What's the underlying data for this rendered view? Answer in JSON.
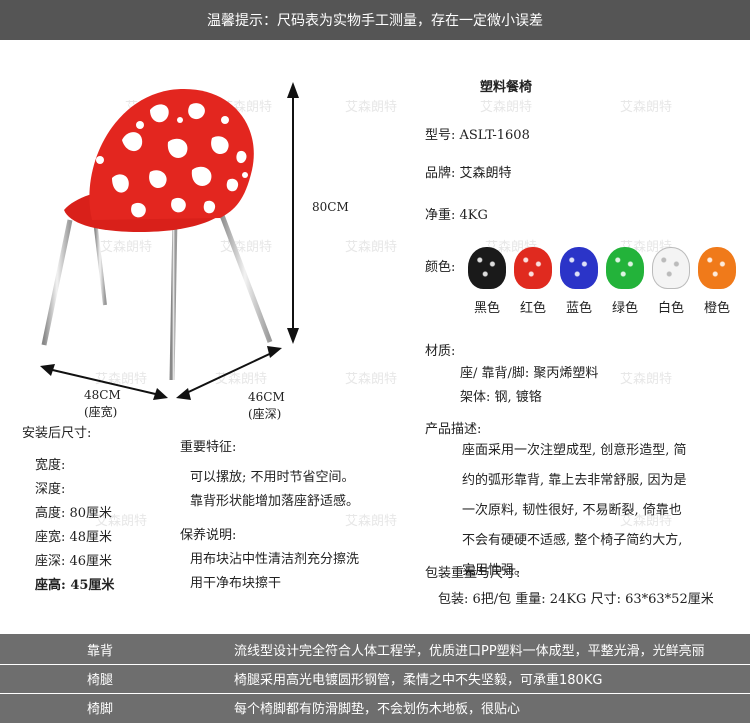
{
  "top_notice": "温馨提示：尺码表为实物手工测量，存在一定微小误差",
  "watermark": "艾森朗特",
  "dims": {
    "height": "80CM",
    "width": "48CM",
    "width_note": "(座宽)",
    "depth": "46CM",
    "depth_note": "(座深)"
  },
  "install": {
    "title": "安装后尺寸:",
    "rows": [
      "宽度:",
      "深度:",
      "高度: 80厘米",
      "座宽: 48厘米",
      "座深: 46厘米",
      "座高: 45厘米"
    ]
  },
  "features": {
    "title": "重要特征:",
    "items": [
      "可以摞放; 不用时节省空间。",
      "靠背形状能增加落座舒适感。"
    ]
  },
  "care": {
    "title": "保养说明:",
    "items": [
      "用布块沾中性清洁剂充分擦洗",
      "用干净布块擦干"
    ]
  },
  "product": {
    "name": "塑料餐椅",
    "model": "型号: ASLT-1608",
    "brand": "品牌: 艾森朗特",
    "weight": "净重: 4KG",
    "color_title": "颜色:",
    "colors": [
      {
        "label": "黑色",
        "hex": "#1a1a1a"
      },
      {
        "label": "红色",
        "hex": "#e02a1f"
      },
      {
        "label": "蓝色",
        "hex": "#2b34c8"
      },
      {
        "label": "绿色",
        "hex": "#23b33a"
      },
      {
        "label": "白色",
        "hex": "#f4f4f4"
      },
      {
        "label": "橙色",
        "hex": "#f07a1a"
      }
    ],
    "material_title": "材质:",
    "material_seat": "座/ 靠背/脚: 聚丙烯塑料",
    "material_frame": "架体: 钢, 镀铬",
    "desc_title": "产品描述:",
    "desc_lines": [
      "座面采用一次注塑成型, 创意形造型, 简",
      "约的弧形靠背, 靠上去非常舒服, 因为是",
      "一次原料, 韧性很好, 不易断裂, 倚靠也",
      "不会有硬硬不适感, 整个椅子简约大方,",
      "实用性强。"
    ],
    "pack_title": "包装重量与尺寸:",
    "pack_detail": "包装: 6把/包  重量: 24KG  尺寸: 63*63*52厘米"
  },
  "bottom_rows": [
    {
      "key": "靠背",
      "value": "流线型设计完全符合人体工程学，优质进口PP塑料一体成型，平整光滑，光鲜亮丽"
    },
    {
      "key": "椅腿",
      "value": "椅腿采用高光电镀圆形钢管，柔情之中不失坚毅，可承重180KG"
    },
    {
      "key": "椅脚",
      "value": "每个椅脚都有防滑脚垫，不会划伤木地板，很贴心"
    }
  ]
}
